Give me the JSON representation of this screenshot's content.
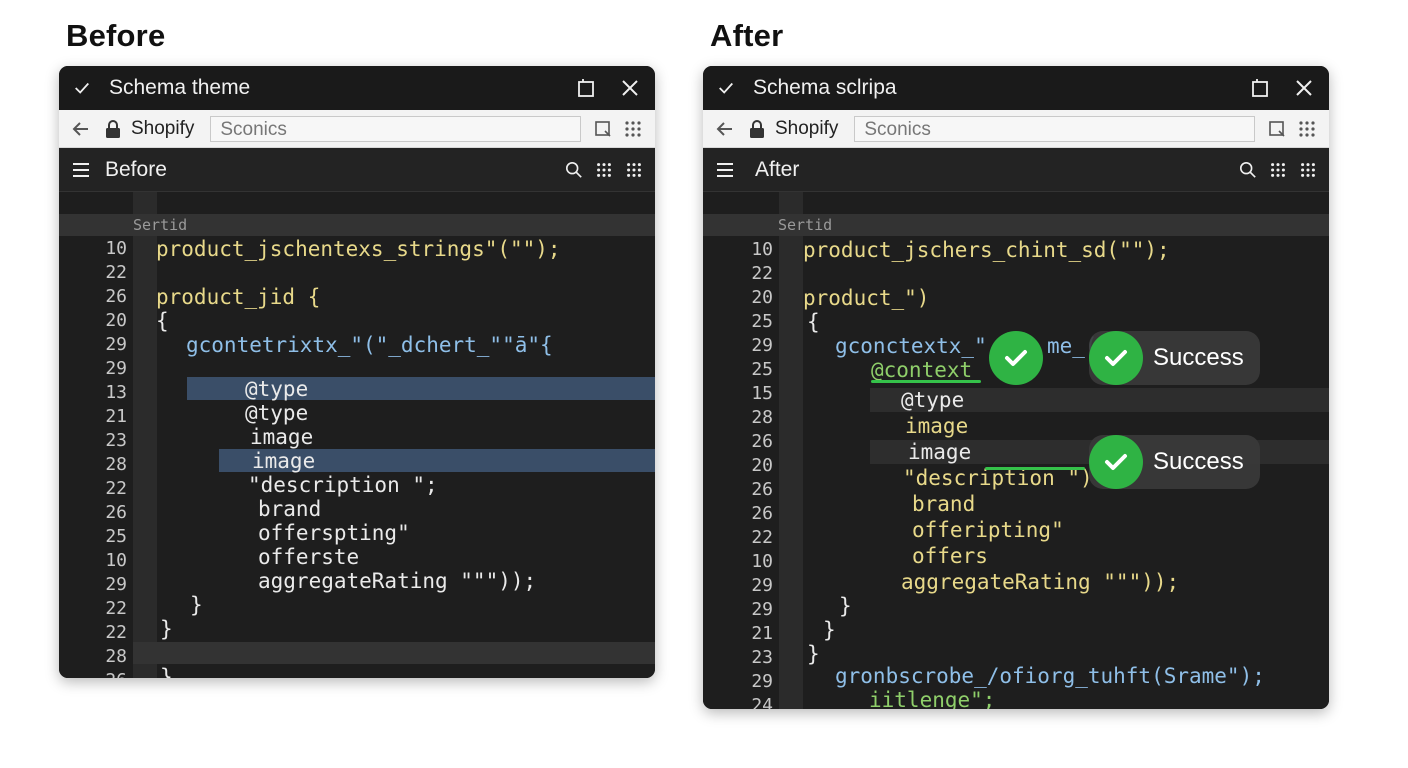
{
  "headings": {
    "left": "Before",
    "right": "After"
  },
  "left": {
    "window_title": "Schema theme",
    "site": "Shopify",
    "url": "Sconics",
    "app_title": "Before",
    "strip_label": "Sertid",
    "line_numbers": [
      "10",
      "22",
      "26",
      "20",
      "29",
      "29",
      "13",
      "21",
      "23",
      "28",
      "22",
      "26",
      "25",
      "10",
      "29",
      "22",
      "22",
      "28",
      "26"
    ],
    "code": [
      "product_jschentexs_strings\"(\"\");",
      "product_jid {",
      "{",
      "gcontetrixtx_\"(\"_dchert_\"\"ā\"{",
      "@type",
      "@type",
      "image",
      "image",
      "\"description \";",
      "brand",
      "offerspting\"",
      "offerste",
      "aggregateRating \"\"\"));",
      "}",
      "}",
      "}"
    ]
  },
  "right": {
    "window_title": "Schema sclripa",
    "site": "Shopify",
    "url": "Sconics",
    "app_title": "After",
    "strip_label": "Sertid",
    "line_numbers": [
      "10",
      "22",
      "20",
      "25",
      "29",
      "25",
      "15",
      "28",
      "26",
      "20",
      "26",
      "26",
      "22",
      "10",
      "29",
      "29",
      "21",
      "23",
      "29",
      "24"
    ],
    "code": [
      "product_jschers_chint_sd(\"\");",
      "product_\")",
      "{",
      "gconctextx_\"",
      "me_(",
      "@context",
      "@type",
      "image",
      "image",
      "\"description \")",
      "brand",
      "offeripting\"",
      "offers",
      "aggregateRating \"\"\"));",
      "}",
      "}",
      "}",
      "gronbscrobe_/ofiorg_tuhft(Srame\");",
      "iitlenge\";"
    ],
    "badges": [
      "Success",
      "Success"
    ]
  },
  "colors": {
    "panel_bg": "#1e1e1e",
    "titlebar_bg": "#1a1a1a",
    "addressbar_bg": "#f3f3f3",
    "selection": "#3a4e68",
    "keyword_yellow": "#e8d98a",
    "keyword_blue": "#8fbfe8",
    "keyword_green": "#8fcf6a",
    "success_green": "#2fb344"
  },
  "icons": [
    "check-icon",
    "window-restore-icon",
    "close-icon",
    "back-arrow-icon",
    "lock-icon",
    "bookmark-icon",
    "grid-icon",
    "menu-icon",
    "search-icon",
    "apps-icon",
    "checkmark-circle-icon"
  ]
}
